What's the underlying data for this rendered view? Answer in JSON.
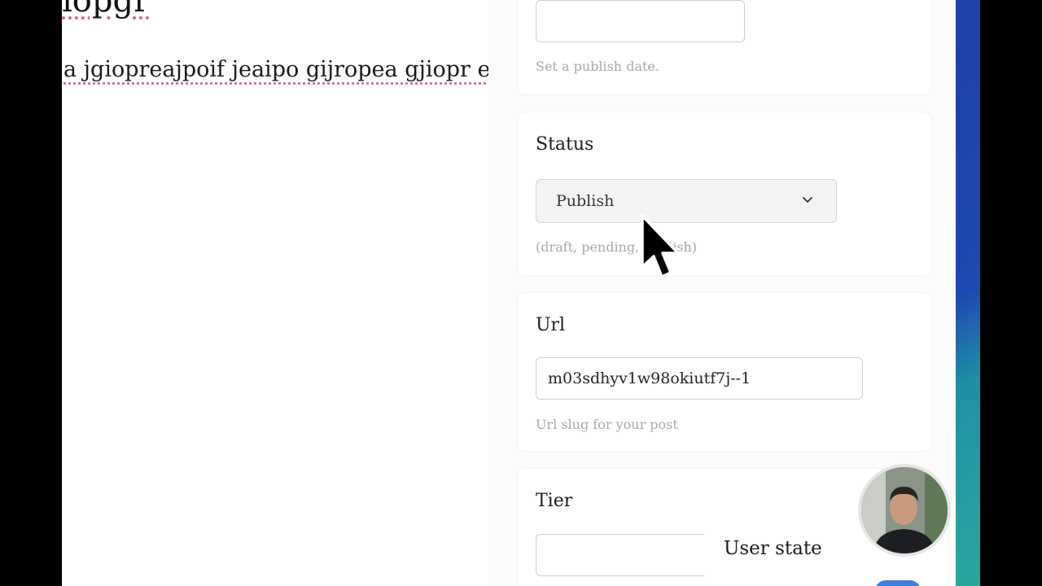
{
  "editor": {
    "heading_fragment": "iopgr",
    "body_text": "a jgiopreajpoif jeaipo gijropea gjiopr eajig"
  },
  "publish_date": {
    "value": "",
    "help": "Set a publish date."
  },
  "status": {
    "label": "Status",
    "selected": "Publish",
    "help": "(draft, pending, publish)"
  },
  "url": {
    "label": "Url",
    "value": "m03sdhyv1w98okiutf7j--1",
    "help": "Url slug for your post"
  },
  "tier": {
    "label": "Tier",
    "value": ""
  },
  "user_state": {
    "label": "User state"
  },
  "colors": {
    "toggle_on": "#3d7fe0",
    "gradient_top": "#1f3fa8",
    "gradient_bottom": "#2aa69a"
  },
  "icons": {
    "status_select": "chevron-down-icon",
    "pointer": "mouse-cursor-icon",
    "webcam": "presenter-webcam"
  }
}
